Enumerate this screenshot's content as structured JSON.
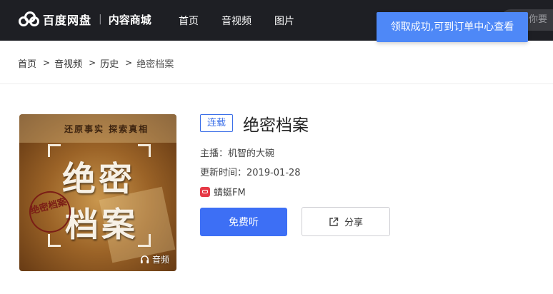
{
  "header": {
    "brand": "百度网盘",
    "brand_sub": "内容商城",
    "separator": "|",
    "nav": [
      "首页",
      "音视频",
      "图片"
    ],
    "search_placeholder": "你要",
    "toast": "领取成功,可到订单中心查看"
  },
  "breadcrumb": [
    "首页",
    "音视频",
    "历史",
    "绝密档案"
  ],
  "breadcrumb_separator": ">",
  "album": {
    "tag": "连载",
    "title": "绝密档案",
    "host": "主播：机智的大碗",
    "updated": "更新时间：2019-01-28",
    "source": "蜻蜓FM",
    "listen_button": "免费听",
    "share_button": "分享",
    "cover": {
      "slogan": "还原事实 探索真相",
      "title_line1": "绝密",
      "title_line2": "档案",
      "stamp": "绝密档案",
      "badge": "音频"
    }
  },
  "colors": {
    "topbar": "#1e1f24",
    "accent": "#3d6ff5",
    "toast": "#4e88f7",
    "fm_brand": "#e63946"
  },
  "icons": [
    "baidu-netdisk-logo-icon",
    "search-icon",
    "headphones-icon",
    "qingting-fm-icon",
    "share-icon"
  ]
}
